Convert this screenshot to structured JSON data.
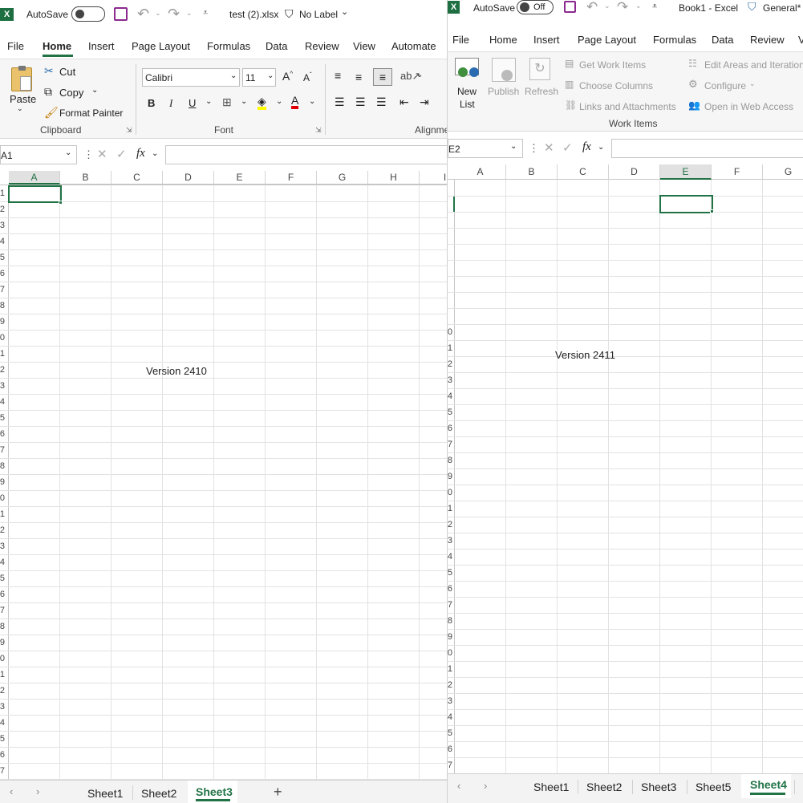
{
  "left": {
    "autosave_label": "AutoSave",
    "file_title": "test (2).xlsx",
    "label_text": "No Label",
    "menu": [
      "File",
      "Home",
      "Insert",
      "Page Layout",
      "Formulas",
      "Data",
      "Review",
      "View",
      "Automate"
    ],
    "clipboard": {
      "paste": "Paste",
      "cut": "Cut",
      "copy": "Copy",
      "format_painter": "Format Painter",
      "group": "Clipboard"
    },
    "font": {
      "name": "Calibri",
      "size": "11",
      "group": "Font",
      "bold": "B",
      "italic": "I",
      "underline": "U"
    },
    "alignment_group": "Alignme",
    "name_box": "A1",
    "columns": [
      "A",
      "B",
      "C",
      "D",
      "E",
      "F",
      "G",
      "H",
      "I"
    ],
    "rows": [
      "1",
      "2",
      "3",
      "4",
      "5",
      "6",
      "7",
      "8",
      "9",
      "0",
      "1",
      "2",
      "3",
      "4",
      "5",
      "6",
      "7",
      "8",
      "9",
      "0",
      "1",
      "2",
      "3",
      "4",
      "5",
      "6",
      "7",
      "8",
      "9",
      "0",
      "1",
      "2",
      "3",
      "4",
      "5",
      "6",
      "7"
    ],
    "cell_text": "Version 2410",
    "sheets": [
      "Sheet1",
      "Sheet2",
      "Sheet3"
    ],
    "add_sheet": "+"
  },
  "right": {
    "autosave_label": "AutoSave",
    "toggle_state": "Off",
    "file_title": "Book1 - Excel",
    "label_text": "General*",
    "menu": [
      "File",
      "Home",
      "Insert",
      "Page Layout",
      "Formulas",
      "Data",
      "Review",
      "V"
    ],
    "ribbon": {
      "new_list": "New",
      "new_list2": "List",
      "publish": "Publish",
      "refresh": "Refresh",
      "get_work_items": "Get Work Items",
      "choose_columns": "Choose Columns",
      "links_attachments": "Links and Attachments",
      "edit_areas": "Edit Areas and Iterations",
      "configure": "Configure",
      "open_web": "Open in Web Access",
      "group": "Work Items"
    },
    "name_box": "E2",
    "columns": [
      "A",
      "B",
      "C",
      "D",
      "E",
      "F",
      "G"
    ],
    "rows": [
      "0",
      "1",
      "2",
      "3",
      "4",
      "5",
      "6",
      "7",
      "8",
      "9",
      "0",
      "1",
      "2",
      "3",
      "4",
      "5",
      "6",
      "7",
      "8",
      "9",
      "0",
      "1",
      "2",
      "3",
      "4",
      "5",
      "6",
      "7"
    ],
    "cell_text": "Version 2411",
    "sheets": [
      "Sheet1",
      "Sheet2",
      "Sheet3",
      "Sheet5",
      "Sheet4"
    ]
  },
  "colors": {
    "accent": "#217346",
    "excel_icon": "#1d6f42",
    "save_icon": "#8b2a8f"
  }
}
